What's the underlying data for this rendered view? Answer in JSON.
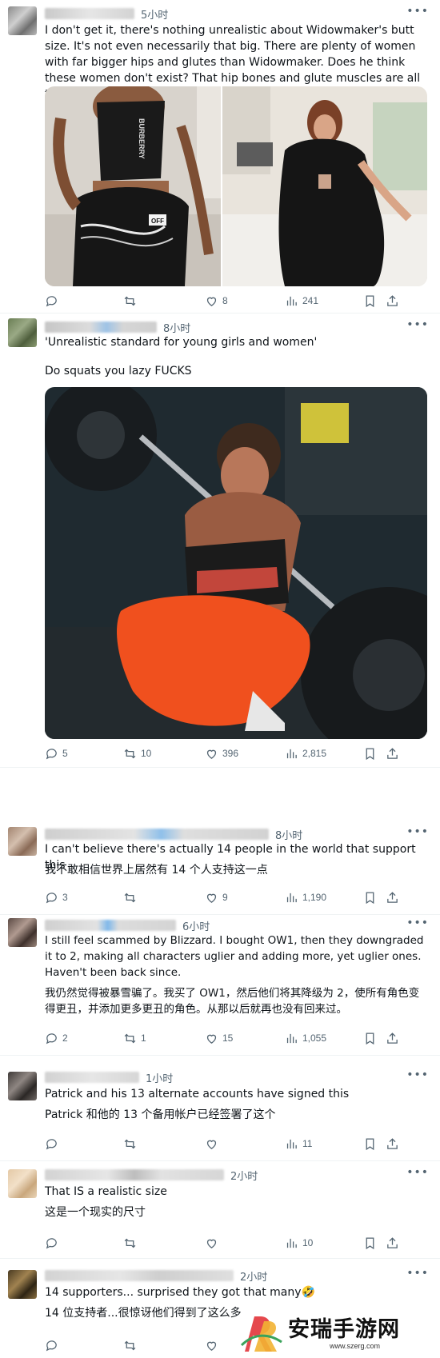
{
  "posts": [
    {
      "time": "5小时",
      "text": "I don't get it, there's nothing unrealistic about Widowmaker's butt size. It's not even necessarily that big. There are plenty of women with far bigger hips and glutes than Widowmaker. Does he think these women don't exist? That hip bones and glute muscles are all the same size?",
      "stats": {
        "replies": "",
        "reposts": "",
        "likes": "8",
        "views": "241"
      }
    },
    {
      "time": "8小时",
      "text": "'Unrealistic standard for young girls and women'",
      "text2": "Do squats you lazy FUCKS",
      "stats": {
        "replies": "5",
        "reposts": "10",
        "likes": "396",
        "views": "2,815"
      }
    },
    {
      "time": "8小时",
      "text": "I can't believe there's actually 14 people in the world that support this",
      "translation": "我不敢相信世界上居然有 14 个人支持这一点",
      "stats": {
        "replies": "3",
        "reposts": "",
        "likes": "9",
        "views": "1,190"
      }
    },
    {
      "time": "6小时",
      "text": "I still feel scammed by Blizzard. I bought OW1, then they downgraded it to 2, making all characters uglier and adding more, yet uglier ones. Haven't been back since.",
      "translation": "我仍然觉得被暴雪骗了。我买了 OW1，然后他们将其降级为 2，使所有角色变得更丑，并添加更多更丑的角色。从那以后就再也没有回来过。",
      "stats": {
        "replies": "2",
        "reposts": "1",
        "likes": "15",
        "views": "1,055"
      }
    },
    {
      "time": "1小时",
      "text": "Patrick and his 13 alternate accounts have signed this",
      "translation": "Patrick 和他的 13 个备用帐户已经签署了这个",
      "stats": {
        "replies": "",
        "reposts": "",
        "likes": "",
        "views": "11"
      }
    },
    {
      "time": "2小时",
      "text": "That IS a realistic size",
      "translation": "这是一个现实的尺寸",
      "stats": {
        "replies": "",
        "reposts": "",
        "likes": "",
        "views": "10"
      }
    },
    {
      "time": "2小时",
      "text": "14 supporters... surprised they got that many🤣",
      "translation": "14 位支持者...很惊讶他们得到了这么多",
      "stats": {
        "replies": "",
        "reposts": "",
        "likes": "",
        "views": ""
      }
    }
  ],
  "media": {
    "image1_left_shirt_text": "BURBERRY",
    "image1_left_badge": "OFF"
  },
  "watermark": {
    "name": "安瑞手游网",
    "url": "www.szerg.com"
  },
  "icons": [
    "reply-icon",
    "repost-icon",
    "like-icon",
    "views-icon",
    "bookmark-icon",
    "share-icon",
    "more-icon"
  ],
  "colors": {
    "text": "#0f1419",
    "muted": "#536471",
    "divider": "#eff3f4",
    "orange": "#f0501e"
  }
}
